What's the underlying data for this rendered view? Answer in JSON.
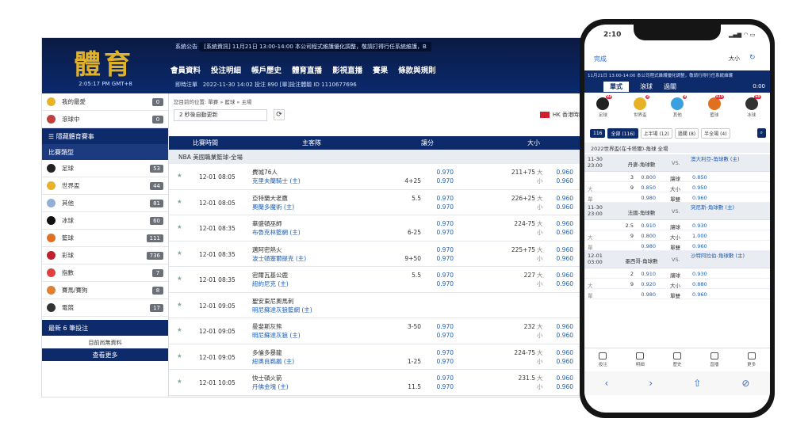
{
  "desktop": {
    "logo": "體育",
    "clock": "2:05:17 PM GMT+8",
    "announcement_label": "系統公告",
    "announcement": "[系統資訊] 11月21日 13:00-14:00 本公司程式維護優化調整，敬請打得行任系統維護，B",
    "nav": [
      "會員資料",
      "投注明細",
      "帳戶歷史",
      "體育直播",
      "影視直播",
      "賽果",
      "條款與規則"
    ],
    "sub_label": "即時注單",
    "sub_text": "2022-11-30 14:02 投注 890 [單]投注體驗 ID 1110677696",
    "sidebar": [
      {
        "label": "我的最愛",
        "count": "0",
        "color": "#e7b224"
      },
      {
        "label": "滾球中",
        "count": "0",
        "color": "#c04040"
      }
    ],
    "sidebar_section": "隱藏體育賽事",
    "sidebar_subsection": "比賽類型",
    "sports": [
      {
        "label": "足球",
        "count": "53",
        "color": "#222"
      },
      {
        "label": "世界盃",
        "count": "44",
        "color": "#e7b224"
      },
      {
        "label": "其他",
        "count": "81",
        "color": "#8fb0d9"
      },
      {
        "label": "冰球",
        "count": "60",
        "color": "#111"
      },
      {
        "label": "籃球",
        "count": "111",
        "color": "#e07020"
      },
      {
        "label": "彩球",
        "count": "736",
        "color": "#c02030"
      },
      {
        "label": "指數",
        "count": "7",
        "color": "#e04040"
      },
      {
        "label": "賽馬/賽狗",
        "count": "8",
        "color": "#e08030"
      },
      {
        "label": "電競",
        "count": "17",
        "color": "#333"
      }
    ],
    "recent_bets_title": "最新 6 筆投注",
    "no_data": "目前尚無資料",
    "more": "查看更多",
    "breadcrumb": "您目前的位置: 單賽 » 籃球 » 主場",
    "refresh_label": "2 秒後自動更新",
    "timezone": "HK 香港時間",
    "col_time": "比賽時間",
    "col_teams": "主客隊",
    "col_handicap": "讓分",
    "col_ou": "大小",
    "league": "NBA 美國職業籃球-全場",
    "matches": [
      {
        "time": "12-01 08:05",
        "home": "費城76人",
        "away": "克里夫蘭騎士 (主)",
        "hc1": "",
        "hc2": "4+25",
        "o1": "0.970",
        "o2": "0.970",
        "ou": "211+75",
        "ov1": "0.960",
        "ov2": "0.960"
      },
      {
        "time": "12-01 08:05",
        "home": "亞特蘭大老鷹",
        "away": "奧蘭多魔術 (主)",
        "hc1": "5.5",
        "hc2": "",
        "o1": "0.970",
        "o2": "0.970",
        "ou": "226+25",
        "ov1": "0.960",
        "ov2": "0.960"
      },
      {
        "time": "12-01 08:35",
        "home": "華盛頓巫師",
        "away": "布魯克林籃網 (主)",
        "hc1": "",
        "hc2": "6-25",
        "o1": "0.970",
        "o2": "0.970",
        "ou": "224-75",
        "ov1": "0.960",
        "ov2": "0.960"
      },
      {
        "time": "12-01 08:35",
        "home": "邁阿密熱火",
        "away": "波士頓塞爾提克 (主)",
        "hc1": "",
        "hc2": "9+50",
        "o1": "0.970",
        "o2": "0.970",
        "ou": "225+75",
        "ov1": "0.960",
        "ov2": "0.960"
      },
      {
        "time": "12-01 08:35",
        "home": "密爾瓦基公鹿",
        "away": "紐約尼克 (主)",
        "hc1": "5.5",
        "hc2": "",
        "o1": "0.970",
        "o2": "0.970",
        "ou": "227",
        "ov1": "0.960",
        "ov2": "0.960"
      },
      {
        "time": "12-01 09:05",
        "home": "聖安東尼奧馬刺",
        "away": "明尼蘇達灰狼籃網 (主)",
        "hc1": "",
        "hc2": "",
        "o1": "",
        "o2": "",
        "ou": "",
        "ov1": "",
        "ov2": ""
      },
      {
        "time": "12-01 09:05",
        "home": "曼斐斯灰熊",
        "away": "明尼蘇達灰狼 (主)",
        "hc1": "3-50",
        "hc2": "",
        "o1": "0.970",
        "o2": "0.970",
        "ou": "232",
        "ov1": "0.960",
        "ov2": "0.960"
      },
      {
        "time": "12-01 09:05",
        "home": "多倫多暴龍",
        "away": "紐奧良鵜鶘 (主)",
        "hc1": "",
        "hc2": "1-25",
        "o1": "0.970",
        "o2": "0.970",
        "ou": "224-75",
        "ov1": "0.960",
        "ov2": "0.960"
      },
      {
        "time": "12-01 10:05",
        "home": "快士頓火箭",
        "away": "丹佛金塊 (主)",
        "hc1": "",
        "hc2": "11.5",
        "o1": "0.970",
        "o2": "0.970",
        "ou": "231.5",
        "ov1": "0.960",
        "ov2": "0.960"
      }
    ]
  },
  "phone": {
    "time": "2:10",
    "done": "完成",
    "aa": "大小",
    "ticker": "11月21日 13:00-14:00 本公司程式維護優化調整，敬請行得行任系統維護",
    "ticker_right": "0:00",
    "tabs": [
      "單式",
      "滾球",
      "過關"
    ],
    "sports": [
      {
        "label": "足球",
        "color": "#222",
        "badge": "84"
      },
      {
        "label": "世界盃",
        "color": "#e7b224",
        "badge": "2"
      },
      {
        "label": "其他",
        "color": "#3aa0e0",
        "badge": "8"
      },
      {
        "label": "籃球",
        "color": "#e07020",
        "badge": "115"
      },
      {
        "label": "冰球",
        "color": "#333",
        "badge": "60"
      }
    ],
    "count": "116",
    "filters": [
      "全部 (116)",
      "上半場 (12)",
      "過關 (8)",
      "半全場 (4)"
    ],
    "league": "2022世界盃(在卡塔爾)-角球 全場",
    "matches": [
      {
        "date": "11-30",
        "time": "23:00",
        "home": "丹麥-角球數",
        "away": "澳大利亞-角球數 (主)",
        "lines": [
          [
            "",
            "3",
            "0.800",
            "讓球",
            "0.850"
          ],
          [
            "大",
            "9",
            "0.850",
            "大小",
            "0.950"
          ],
          [
            "單",
            "",
            "0.980",
            "單雙",
            "0.960"
          ]
        ]
      },
      {
        "date": "11-30",
        "time": "23:00",
        "home": "法國-角球數",
        "away": "突尼斯-角球數 (主)",
        "lines": [
          [
            "",
            "2.5",
            "0.910",
            "讓球",
            "0.930"
          ],
          [
            "大",
            "9",
            "0.800",
            "大小",
            "1.000"
          ],
          [
            "單",
            "",
            "0.980",
            "單雙",
            "0.960"
          ]
        ]
      },
      {
        "date": "12-01",
        "time": "03:00",
        "home": "墨西哥-角球數",
        "away": "沙特阿拉伯-角球數 (主)",
        "lines": [
          [
            "",
            "2",
            "0.910",
            "讓球",
            "0.930"
          ],
          [
            "大",
            "9",
            "0.920",
            "大小",
            "0.880"
          ],
          [
            "單",
            "",
            "0.980",
            "單雙",
            "0.960"
          ]
        ]
      }
    ],
    "bottom": [
      "投注",
      "明細",
      "歷史",
      "直播",
      "更多"
    ],
    "browser": [
      "‹",
      "›",
      "⇧",
      "⊘"
    ]
  }
}
